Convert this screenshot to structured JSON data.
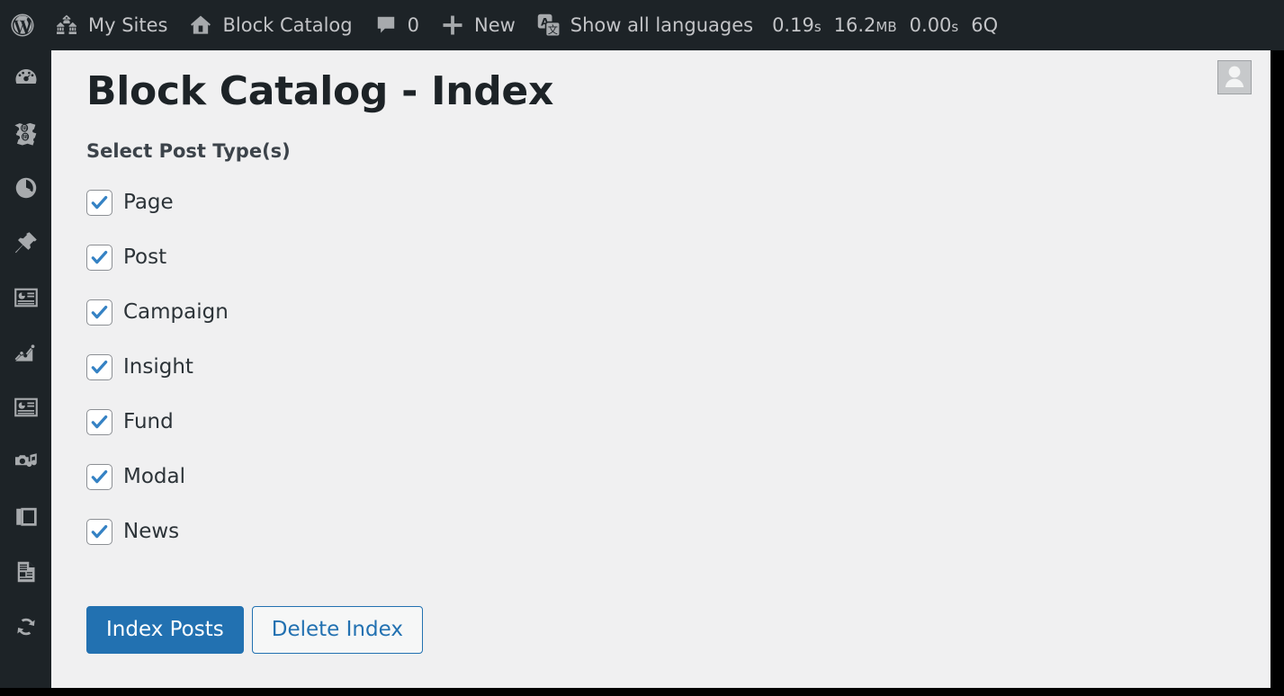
{
  "adminbar": {
    "wp_logo": {
      "icon": "wordpress-logo-icon",
      "label": ""
    },
    "my_sites": {
      "icon": "my-sites-icon",
      "label": "My Sites"
    },
    "site_name": {
      "icon": "home-icon",
      "label": "Block Catalog"
    },
    "comments": {
      "icon": "comment-bubble-icon",
      "count": "0"
    },
    "new_content": {
      "icon": "plus-icon",
      "label": "New"
    },
    "languages": {
      "icon": "translation-icon",
      "label": "Show all languages"
    },
    "performance": {
      "load_time": "0.19",
      "load_time_unit": "s",
      "memory": "16.2",
      "memory_unit": "MB",
      "db_time": "0.00",
      "db_time_unit": "s",
      "queries": "6Q"
    }
  },
  "sidebar": {
    "items": [
      {
        "icon": "dashboard-gauge-icon",
        "name": "sidebar-item-dashboard"
      },
      {
        "icon": "coupons-tickets-icon",
        "name": "sidebar-item-coupons"
      },
      {
        "icon": "performance-pie-icon",
        "name": "sidebar-item-performance"
      },
      {
        "icon": "pin-icon",
        "name": "sidebar-item-posts"
      },
      {
        "icon": "layout-preview-icon",
        "name": "sidebar-item-layout"
      },
      {
        "icon": "analytics-chart-icon",
        "name": "sidebar-item-analytics"
      },
      {
        "icon": "layout-preview-icon",
        "name": "sidebar-item-pages-preview"
      },
      {
        "icon": "media-camera-music-icon",
        "name": "sidebar-item-media"
      },
      {
        "icon": "pages-stack-icon",
        "name": "sidebar-item-pages"
      },
      {
        "icon": "document-lines-icon",
        "name": "sidebar-item-documents"
      },
      {
        "icon": "sync-update-icon",
        "name": "sidebar-item-updates"
      }
    ]
  },
  "content": {
    "avatar": {
      "icon": "avatar-placeholder-icon"
    },
    "title": "Block Catalog - Index",
    "section_label": "Select Post Type(s)",
    "post_types": [
      {
        "label": "Page",
        "checked": true
      },
      {
        "label": "Post",
        "checked": true
      },
      {
        "label": "Campaign",
        "checked": true
      },
      {
        "label": "Insight",
        "checked": true
      },
      {
        "label": "Fund",
        "checked": true
      },
      {
        "label": "Modal",
        "checked": true
      },
      {
        "label": "News",
        "checked": true
      }
    ],
    "buttons": {
      "primary": "Index Posts",
      "secondary": "Delete Index"
    }
  },
  "colors": {
    "admin_chrome": "#1d2327",
    "content_bg": "#f0f0f1",
    "accent_blue": "#2271b1",
    "icon_gray": "#a7aaad",
    "text_dark": "#1d2327"
  }
}
